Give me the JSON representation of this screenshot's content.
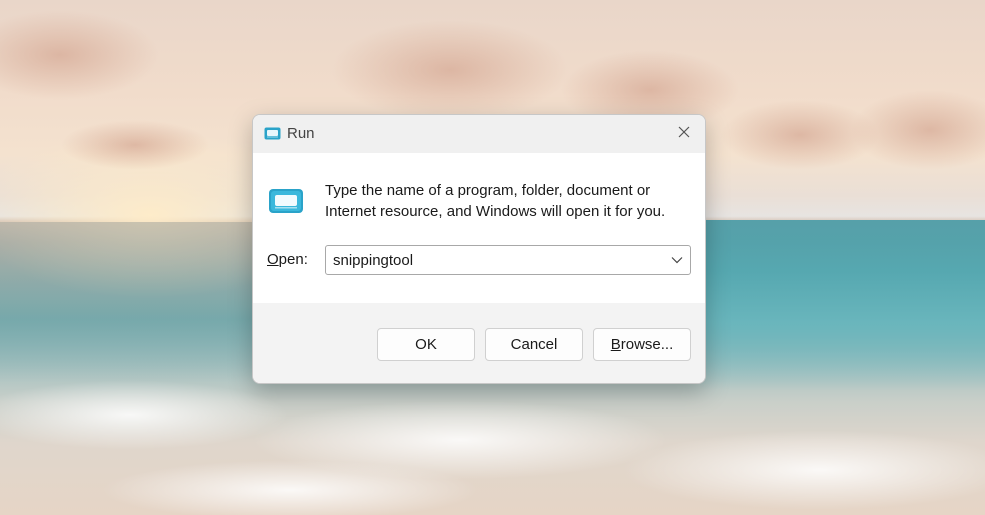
{
  "dialog": {
    "title": "Run",
    "description": "Type the name of a program, folder, document or Internet resource, and Windows will open it for you.",
    "open_label_accesskey": "O",
    "open_label_rest": "pen:",
    "open_value": "snippingtool",
    "ok_label": "OK",
    "cancel_label": "Cancel",
    "browse_label_accesskey": "B",
    "browse_label_rest": "rowse..."
  },
  "icons": {
    "title": "run-icon",
    "large": "run-icon",
    "close": "close-icon",
    "dropdown": "chevron-down-icon"
  },
  "colors": {
    "run_icon_teal": "#2aa3c9",
    "dialog_background": "#f3f3f3",
    "content_background": "#ffffff"
  }
}
